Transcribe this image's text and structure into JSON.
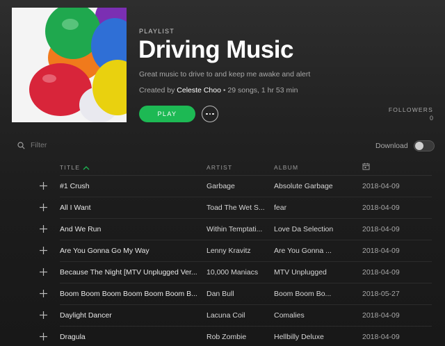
{
  "playlist": {
    "kind_label": "PLAYLIST",
    "title": "Driving Music",
    "description": "Great music to drive to and keep me awake and alert",
    "created_by_prefix": "Created by",
    "owner": "Celeste Choo",
    "stats": " • 29 songs, 1 hr 53 min",
    "cover_icon": "balloons-image"
  },
  "actions": {
    "play_label": "PLAY",
    "more_icon": "ellipsis-icon"
  },
  "followers": {
    "label": "FOLLOWERS",
    "count": "0"
  },
  "filter": {
    "placeholder": "Filter",
    "icon": "search-icon"
  },
  "download": {
    "label": "Download",
    "enabled": false
  },
  "columns": {
    "title": "TITLE",
    "artist": "ARTIST",
    "album": "ALBUM",
    "date_icon": "calendar-icon"
  },
  "tracks": [
    {
      "title": "#1 Crush",
      "artist": "Garbage",
      "album": "Absolute Garbage",
      "date": "2018-04-09"
    },
    {
      "title": "All I Want",
      "artist": "Toad The Wet S...",
      "album": "fear",
      "date": "2018-04-09"
    },
    {
      "title": "And We Run",
      "artist": "Within Temptati...",
      "album": "Love Da Selection",
      "date": "2018-04-09"
    },
    {
      "title": "Are You Gonna Go My Way",
      "artist": "Lenny Kravitz",
      "album": "Are You Gonna ...",
      "date": "2018-04-09"
    },
    {
      "title": "Because The Night [MTV Unplugged Ver...",
      "artist": "10,000 Maniacs",
      "album": "MTV Unplugged",
      "date": "2018-04-09"
    },
    {
      "title": "Boom Boom Boom Boom Boom Boom B...",
      "artist": "Dan Bull",
      "album": "Boom Boom Bo...",
      "date": "2018-05-27"
    },
    {
      "title": "Daylight Dancer",
      "artist": "Lacuna Coil",
      "album": "Comalies",
      "date": "2018-04-09"
    },
    {
      "title": "Dragula",
      "artist": "Rob Zombie",
      "album": "Hellbilly Deluxe",
      "date": "2018-04-09"
    }
  ],
  "colors": {
    "accent": "#1db954",
    "background": "#181818"
  }
}
